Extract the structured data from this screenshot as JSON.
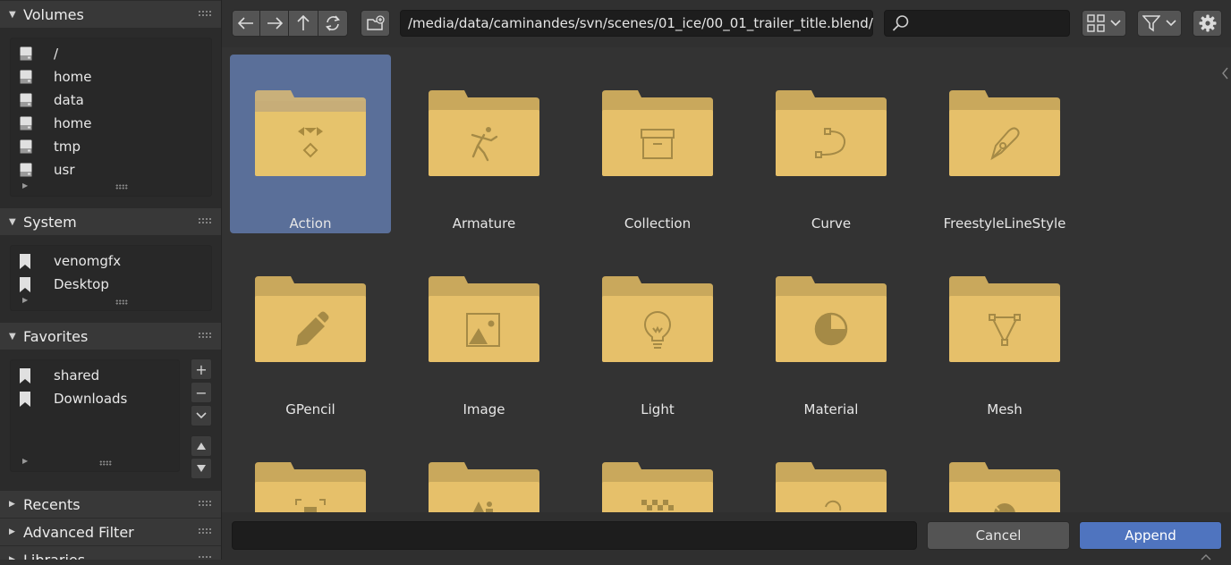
{
  "sidebar": {
    "volumes": {
      "title": "Volumes",
      "items": [
        "/",
        "home",
        "data",
        "home",
        "tmp",
        "usr"
      ]
    },
    "system": {
      "title": "System",
      "items": [
        "venomgfx",
        "Desktop"
      ]
    },
    "favorites": {
      "title": "Favorites",
      "items": [
        "shared",
        "Downloads"
      ]
    },
    "recents": {
      "title": "Recents"
    },
    "advanced_filter": {
      "title": "Advanced Filter"
    },
    "libraries": {
      "title": "Libraries"
    }
  },
  "toolbar": {
    "path": "/media/data/caminandes/svn/scenes/01_ice/00_01_trailer_title.blend/",
    "search_value": ""
  },
  "grid": {
    "items": [
      {
        "label": "Action",
        "icon": "action-icon",
        "selected": true
      },
      {
        "label": "Armature",
        "icon": "armature-icon"
      },
      {
        "label": "Collection",
        "icon": "collection-icon"
      },
      {
        "label": "Curve",
        "icon": "curve-icon"
      },
      {
        "label": "FreestyleLineStyle",
        "icon": "linestyle-icon"
      },
      {
        "label": "GPencil",
        "icon": "gpencil-icon"
      },
      {
        "label": "Image",
        "icon": "image-icon"
      },
      {
        "label": "Light",
        "icon": "light-icon"
      },
      {
        "label": "Material",
        "icon": "material-icon"
      },
      {
        "label": "Mesh",
        "icon": "mesh-icon"
      }
    ]
  },
  "bottom": {
    "filename_value": "",
    "cancel_label": "Cancel",
    "append_label": "Append"
  },
  "colors": {
    "folder": "#e6c06a",
    "folder_tab": "#c9a85c",
    "selection": "#5a6f99",
    "append_button": "#4f74bf"
  }
}
